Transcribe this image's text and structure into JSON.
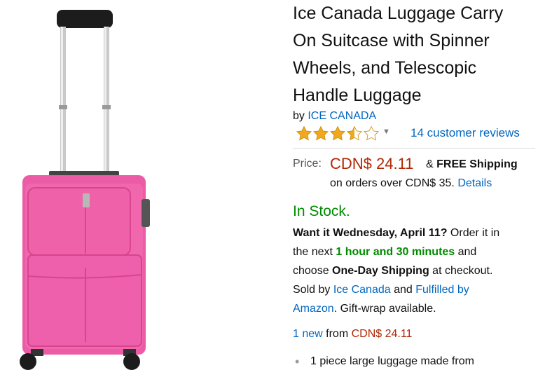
{
  "product": {
    "title_lines": [
      "Ice Canada Luggage Carry",
      "On Suitcase with Spinner",
      "Wheels, and Telescopic",
      "Handle Luggage"
    ],
    "by_prefix": "by",
    "brand": "ICE CANADA"
  },
  "rating": {
    "stars": 3.5,
    "max": 5,
    "star_color": "#f0a81e",
    "reviews_label": "14 customer reviews"
  },
  "price": {
    "label": "Price:",
    "value": "CDN$ 24.11",
    "amp": "&",
    "free_shipping": "FREE Shipping",
    "line2_prefix": "on orders over CDN$ 35.",
    "details_link": "Details"
  },
  "availability": {
    "stock": "In Stock.",
    "want_it": "Want it Wednesday, April 11?",
    "order_it": " Order it in",
    "the_next": "the next ",
    "time_left": "1 hour and 30 minutes",
    "and_text": " and",
    "choose": "choose ",
    "one_day": "One-Day Shipping",
    "at_checkout": " at checkout.",
    "sold_by": "Sold by ",
    "seller": "Ice Canada",
    "and2": " and ",
    "fulfilled": "Fulfilled by",
    "amazon": "Amazon",
    "giftwrap": ". Gift-wrap available."
  },
  "offers": {
    "new_link": "1 new",
    "from": " from ",
    "price": "CDN$ 24.11"
  },
  "bullets": [
    "1 piece large luggage made from"
  ],
  "colors": {
    "link": "#0066c0",
    "price": "#b12704",
    "stock": "#008a00",
    "suitcase": "#ee5da6"
  }
}
